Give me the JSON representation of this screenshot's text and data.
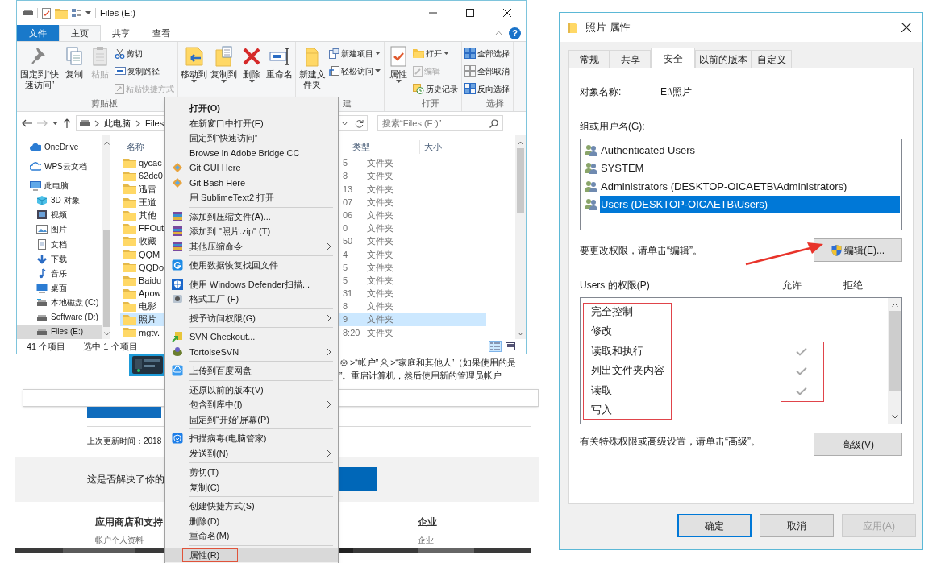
{
  "background_page": {
    "breadcrumb_1": ">“帐户”",
    "breadcrumb_2": ">“家庭和其他人”（如果使用的是",
    "instruction_tail": "”。重启计算机，然后使用新的管理员帐户",
    "updated": "上次更新时间：2018",
    "feedback_question": "这是否解决了你的",
    "footer_columns": [
      {
        "heading": "应用商店和支持",
        "link": "帐户个人资料"
      },
      {
        "heading": "企业",
        "link": "企业"
      }
    ]
  },
  "explorer": {
    "title": "Files (E:)",
    "tabs": [
      {
        "label": "文件",
        "kind": "file",
        "selected": false
      },
      {
        "label": "主页",
        "kind": "tab",
        "selected": true
      },
      {
        "label": "共享",
        "kind": "tab",
        "selected": false
      },
      {
        "label": "查看",
        "kind": "tab",
        "selected": false
      }
    ],
    "help": "?",
    "ribbon_groups": [
      {
        "label": "剪贴板",
        "commands": [
          {
            "label": "固定到“快速访问”",
            "kind": "large",
            "disabled": false,
            "dropdown": false
          },
          {
            "label": "复制",
            "kind": "large",
            "disabled": false,
            "dropdown": false
          },
          {
            "label": "粘贴",
            "kind": "large",
            "disabled": true,
            "dropdown": false
          },
          {
            "label": "剪切",
            "kind": "small",
            "disabled": false,
            "dropdown": false
          },
          {
            "label": "复制路径",
            "kind": "small",
            "disabled": false,
            "dropdown": false
          },
          {
            "label": "粘贴快捷方式",
            "kind": "small",
            "disabled": true,
            "dropdown": false
          }
        ]
      },
      {
        "commands": [
          {
            "label": "移动到",
            "kind": "large",
            "disabled": false,
            "dropdown": true
          },
          {
            "label": "复制到",
            "kind": "large",
            "disabled": false,
            "dropdown": true
          },
          {
            "label": "删除",
            "kind": "large",
            "disabled": false,
            "dropdown": true
          },
          {
            "label": "重命名",
            "kind": "large",
            "disabled": false,
            "dropdown": false
          }
        ]
      },
      {
        "label": "建",
        "commands": [
          {
            "label": "新建文件夹",
            "kind": "large",
            "disabled": false,
            "dropdown": false
          },
          {
            "label": "新建项目",
            "kind": "small",
            "disabled": false,
            "dropdown": true
          },
          {
            "label": "轻松访问",
            "kind": "small",
            "disabled": false,
            "dropdown": true
          }
        ]
      },
      {
        "label": "打开",
        "commands": [
          {
            "label": "属性",
            "kind": "large",
            "disabled": false,
            "dropdown": true
          },
          {
            "label": "打开",
            "kind": "small",
            "disabled": false,
            "dropdown": true
          },
          {
            "label": "编辑",
            "kind": "small",
            "disabled": true,
            "dropdown": false
          },
          {
            "label": "历史记录",
            "kind": "small",
            "disabled": false,
            "dropdown": false
          }
        ]
      },
      {
        "label": "选择",
        "commands": [
          {
            "label": "全部选择",
            "kind": "small",
            "disabled": false,
            "dropdown": false
          },
          {
            "label": "全部取消",
            "kind": "small",
            "disabled": false,
            "dropdown": false
          },
          {
            "label": "反向选择",
            "kind": "small",
            "disabled": false,
            "dropdown": false
          }
        ]
      }
    ],
    "address": {
      "crumbs": [
        "此电脑",
        "Files"
      ]
    },
    "search": {
      "placeholder": "搜索“Files (E:)”"
    },
    "nav": [
      {
        "label": "OneDrive",
        "selected": false
      },
      {
        "label": "WPS云文档",
        "selected": false
      },
      {
        "label": "此电脑",
        "selected": false,
        "children": [
          {
            "label": "3D 对象",
            "selected": false
          },
          {
            "label": "视频",
            "selected": false
          },
          {
            "label": "图片",
            "selected": false
          },
          {
            "label": "文档",
            "selected": false
          },
          {
            "label": "下载",
            "selected": false
          },
          {
            "label": "音乐",
            "selected": false
          },
          {
            "label": "桌面",
            "selected": false
          },
          {
            "label": "本地磁盘 (C:)",
            "selected": false
          },
          {
            "label": "Software (D:)",
            "selected": false
          },
          {
            "label": "Files (E:)",
            "selected": true
          }
        ]
      }
    ],
    "columns": [
      "名称",
      "类型",
      "大小"
    ],
    "rows": [
      {
        "name": "qycac",
        "column_2": "5",
        "type": "文件夹",
        "selected": false
      },
      {
        "name": "62dc0",
        "column_2": "8",
        "type": "文件夹",
        "selected": false
      },
      {
        "name": "迅雷",
        "column_2": "13",
        "type": "文件夹",
        "selected": false
      },
      {
        "name": "王道",
        "column_2": "07",
        "type": "文件夹",
        "selected": false
      },
      {
        "name": "其他",
        "column_2": "06",
        "type": "文件夹",
        "selected": false
      },
      {
        "name": "FFOut",
        "column_2": "0",
        "type": "文件夹",
        "selected": false
      },
      {
        "name": "收藏",
        "column_2": "50",
        "type": "文件夹",
        "selected": false
      },
      {
        "name": "QQM",
        "column_2": "4",
        "type": "文件夹",
        "selected": false
      },
      {
        "name": "QQDo",
        "column_2": "5",
        "type": "文件夹",
        "selected": false
      },
      {
        "name": "Baidu",
        "column_2": "5",
        "type": "文件夹",
        "selected": false
      },
      {
        "name": "Apow",
        "column_2": "31",
        "type": "文件夹",
        "selected": false
      },
      {
        "name": "电影",
        "column_2": "8",
        "type": "文件夹",
        "selected": false
      },
      {
        "name": "照片",
        "column_2": "9",
        "type": "文件夹",
        "selected": true
      },
      {
        "name": "mgtv.",
        "column_2": "8:20",
        "type": "文件夹",
        "selected": false
      }
    ],
    "status": [
      "41 个项目",
      "选中 1 个项目"
    ]
  },
  "context_menu": {
    "sections": [
      [
        {
          "label": "打开(O)",
          "bold": true,
          "submenu": false,
          "highlighted": false
        },
        {
          "label": "在新窗口中打开(E)",
          "bold": false,
          "submenu": false,
          "highlighted": false
        },
        {
          "label": "固定到“快速访问”",
          "bold": false,
          "submenu": false,
          "highlighted": false
        },
        {
          "label": "Browse in Adobe Bridge CC",
          "bold": false,
          "submenu": false,
          "highlighted": false
        },
        {
          "label": "Git GUI Here",
          "bold": false,
          "submenu": false,
          "highlighted": false
        },
        {
          "label": "Git Bash Here",
          "bold": false,
          "submenu": false,
          "highlighted": false
        },
        {
          "label": "用 SublimeText2 打开",
          "bold": false,
          "submenu": false,
          "highlighted": false
        }
      ],
      [
        {
          "label": "添加到压缩文件(A)...",
          "bold": false,
          "submenu": false,
          "highlighted": false
        },
        {
          "label": "添加到 \"照片.zip\" (T)",
          "bold": false,
          "submenu": false,
          "highlighted": false
        },
        {
          "label": "其他压缩命令",
          "bold": false,
          "submenu": true,
          "highlighted": false
        }
      ],
      [
        {
          "label": "使用数据恢复找回文件",
          "bold": false,
          "submenu": false,
          "highlighted": false
        }
      ],
      [
        {
          "label": "使用 Windows Defender扫描...",
          "bold": false,
          "submenu": false,
          "highlighted": false
        },
        {
          "label": "格式工厂 (F)",
          "bold": false,
          "submenu": false,
          "highlighted": false
        }
      ],
      [
        {
          "label": "授予访问权限(G)",
          "bold": false,
          "submenu": true,
          "highlighted": false
        }
      ],
      [
        {
          "label": "SVN Checkout...",
          "bold": false,
          "submenu": false,
          "highlighted": false
        },
        {
          "label": "TortoiseSVN",
          "bold": false,
          "submenu": true,
          "highlighted": false
        }
      ],
      [
        {
          "label": "上传到百度网盘",
          "bold": false,
          "submenu": false,
          "highlighted": false
        }
      ],
      [
        {
          "label": "还原以前的版本(V)",
          "bold": false,
          "submenu": false,
          "highlighted": false
        },
        {
          "label": "包含到库中(I)",
          "bold": false,
          "submenu": true,
          "highlighted": false
        },
        {
          "label": "固定到“开始”屏幕(P)",
          "bold": false,
          "submenu": false,
          "highlighted": false
        }
      ],
      [
        {
          "label": "扫描病毒(电脑管家)",
          "bold": false,
          "submenu": false,
          "highlighted": false
        },
        {
          "label": "发送到(N)",
          "bold": false,
          "submenu": true,
          "highlighted": false
        }
      ],
      [
        {
          "label": "剪切(T)",
          "bold": false,
          "submenu": false,
          "highlighted": false
        },
        {
          "label": "复制(C)",
          "bold": false,
          "submenu": false,
          "highlighted": false
        }
      ],
      [
        {
          "label": "创建快捷方式(S)",
          "bold": false,
          "submenu": false,
          "highlighted": false
        },
        {
          "label": "删除(D)",
          "bold": false,
          "submenu": false,
          "highlighted": false
        },
        {
          "label": "重命名(M)",
          "bold": false,
          "submenu": false,
          "highlighted": false
        }
      ],
      [
        {
          "label": "属性(R)",
          "bold": false,
          "submenu": false,
          "highlighted": true
        }
      ]
    ]
  },
  "properties_dialog": {
    "title": "照片 属性",
    "tabs": [
      {
        "label": "常规",
        "selected": false
      },
      {
        "label": "共享",
        "selected": false
      },
      {
        "label": "安全",
        "selected": true
      },
      {
        "label": "以前的版本",
        "selected": false
      },
      {
        "label": "自定义",
        "selected": false
      }
    ],
    "object_name_label": "对象名称:",
    "object_name": "E:\\照片",
    "groups_label": "组或用户名(G):",
    "principals": [
      {
        "name": "Authenticated Users",
        "selected": false
      },
      {
        "name": "SYSTEM",
        "selected": false
      },
      {
        "name": "Administrators (DESKTOP-OICAETB\\Administrators)",
        "selected": false
      },
      {
        "name": "Users (DESKTOP-OICAETB\\Users)",
        "selected": true
      }
    ],
    "edit_hint": "要更改权限，请单击“编辑”。",
    "edit_button": "编辑(E)...",
    "permissions_label": "Users 的权限(P)",
    "allow_header": "允许",
    "deny_header": "拒绝",
    "permissions": [
      {
        "name": "完全控制",
        "allow": false,
        "deny": false
      },
      {
        "name": "修改",
        "allow": false,
        "deny": false
      },
      {
        "name": "读取和执行",
        "allow": true,
        "deny": false
      },
      {
        "name": "列出文件夹内容",
        "allow": true,
        "deny": false
      },
      {
        "name": "读取",
        "allow": true,
        "deny": false
      },
      {
        "name": "写入",
        "allow": false,
        "deny": false
      }
    ],
    "advanced_hint": "有关特殊权限或高级设置，请单击“高级”。",
    "advanced_button": "高级(V)",
    "buttons": [
      {
        "label": "确定",
        "kind": "default",
        "disabled": false
      },
      {
        "label": "取消",
        "kind": "normal",
        "disabled": false
      },
      {
        "label": "应用(A)",
        "kind": "normal",
        "disabled": true
      }
    ]
  }
}
